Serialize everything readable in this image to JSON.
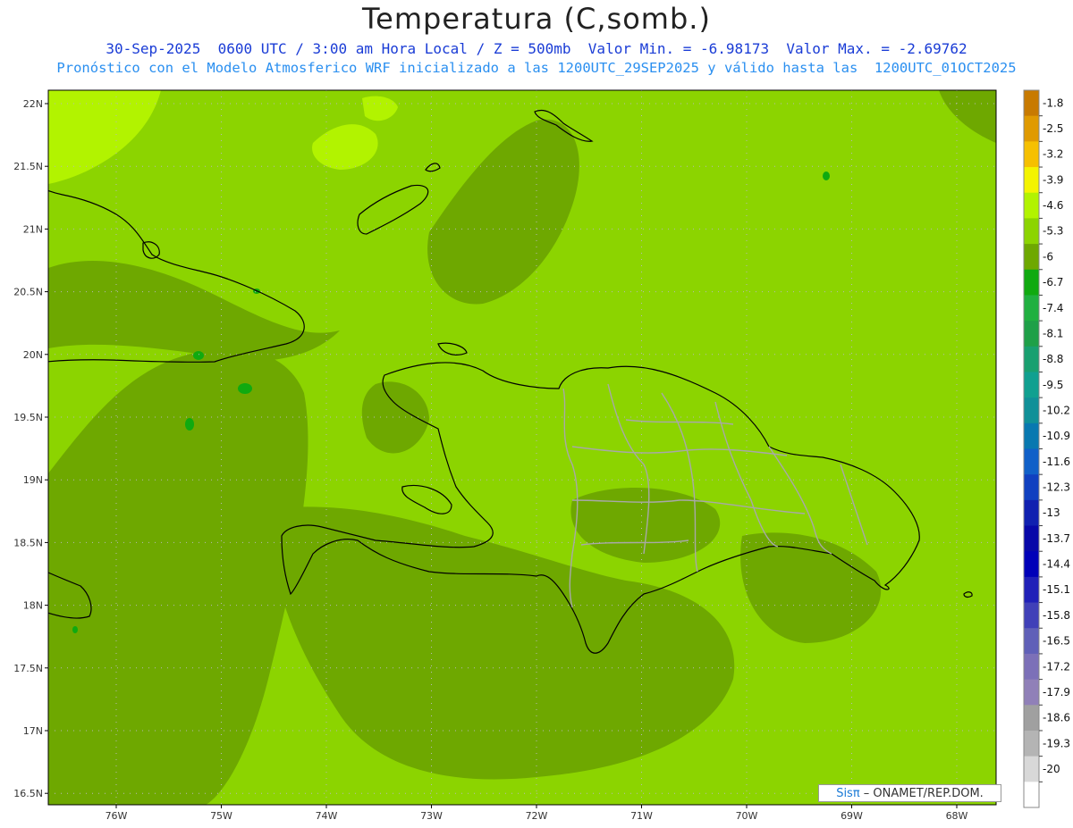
{
  "title": "Temperatura (C,somb.)",
  "subtitle_line1": "30-Sep-2025  0600 UTC / 3:00 am Hora Local / Z = 500mb  Valor Min. = -6.98173  Valor Max. = -2.69762",
  "subtitle_line2": "Pronóstico con el Modelo Atmosferico WRF inicializado a las 1200UTC_29SEP2025 y válido hasta las  1200UTC_01OCT2025",
  "credit": {
    "brand": "Sisπ",
    "text": " – ONAMET/REP.DOM."
  },
  "lat_labels": [
    "22N",
    "21.5N",
    "21N",
    "20.5N",
    "20N",
    "19.5N",
    "19N",
    "18.5N",
    "18N",
    "17.5N",
    "17N",
    "16.5N"
  ],
  "lon_labels": [
    "76W",
    "75W",
    "74W",
    "73W",
    "72W",
    "71W",
    "70W",
    "69W",
    "68W"
  ],
  "colorbar": {
    "labels": [
      "-1.8",
      "-2.5",
      "-3.2",
      "-3.9",
      "-4.6",
      "-5.3",
      "-6",
      "-6.7",
      "-7.4",
      "-8.1",
      "-8.8",
      "-9.5",
      "-10.2",
      "-10.9",
      "-11.6",
      "-12.3",
      "-13",
      "-13.7",
      "-14.4",
      "-15.1",
      "-15.8",
      "-16.5",
      "-17.2",
      "-17.9",
      "-18.6",
      "-19.3",
      "-20"
    ],
    "colors": [
      "#c87a00",
      "#e09a00",
      "#f6c000",
      "#f4f400",
      "#b2f300",
      "#8cd400",
      "#6ea800",
      "#10aa10",
      "#20b040",
      "#1ea048",
      "#18a070",
      "#10a090",
      "#109098",
      "#0878b0",
      "#1060c8",
      "#1040c0",
      "#1020b0",
      "#0808a8",
      "#0000b8",
      "#2020b8",
      "#4040b8",
      "#6060b8",
      "#7c70b8",
      "#9080b8",
      "#a0a0a0",
      "#b4b4b4",
      "#d8d8d8",
      "#ffffff"
    ]
  },
  "field_colors": {
    "base": "#8cd400",
    "darker": "#6ea800",
    "lighter": "#b2f300",
    "darkest": "#10aa10"
  }
}
